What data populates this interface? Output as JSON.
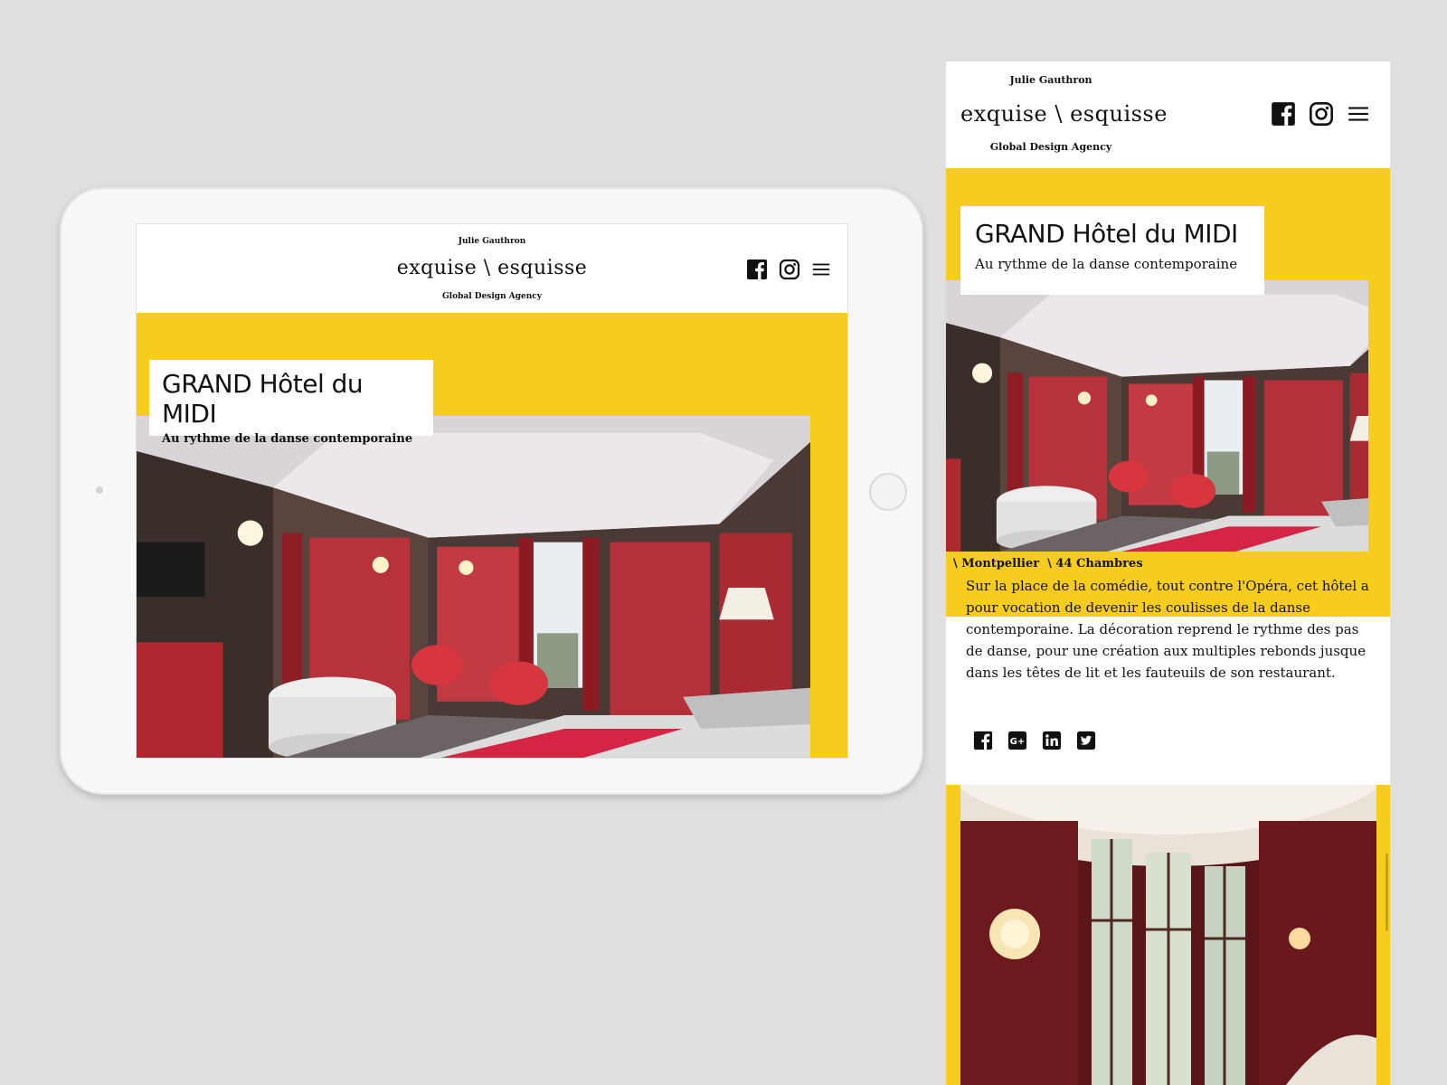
{
  "brand": {
    "author": "Julie Gauthron",
    "logo": "exquise \\ esquisse",
    "tagline": "Global Design Agency"
  },
  "header_icons": [
    "facebook-icon",
    "instagram-icon",
    "menu-icon"
  ],
  "project": {
    "title": "GRAND Hôtel du MIDI",
    "subtitle": "Au rythme de la danse contemporaine",
    "tag_city": "\\ Montpellier",
    "tag_rooms": "\\ 44 Chambres",
    "description": "Sur la place de la comédie, tout contre l'Opéra, cet hôtel a pour vocation de devenir les coulisses de la danse contemporaine. La décoration reprend le rythme des pas de danse, pour une création aux multiples rebonds jusque dans les têtes de lit et les fauteuils de son restaurant."
  },
  "share_icons": [
    "facebook-icon",
    "google-plus-icon",
    "linkedin-icon",
    "twitter-icon"
  ],
  "colors": {
    "accent_yellow": "#f7cd1d",
    "background": "#dfdfdf",
    "text": "#111111"
  }
}
